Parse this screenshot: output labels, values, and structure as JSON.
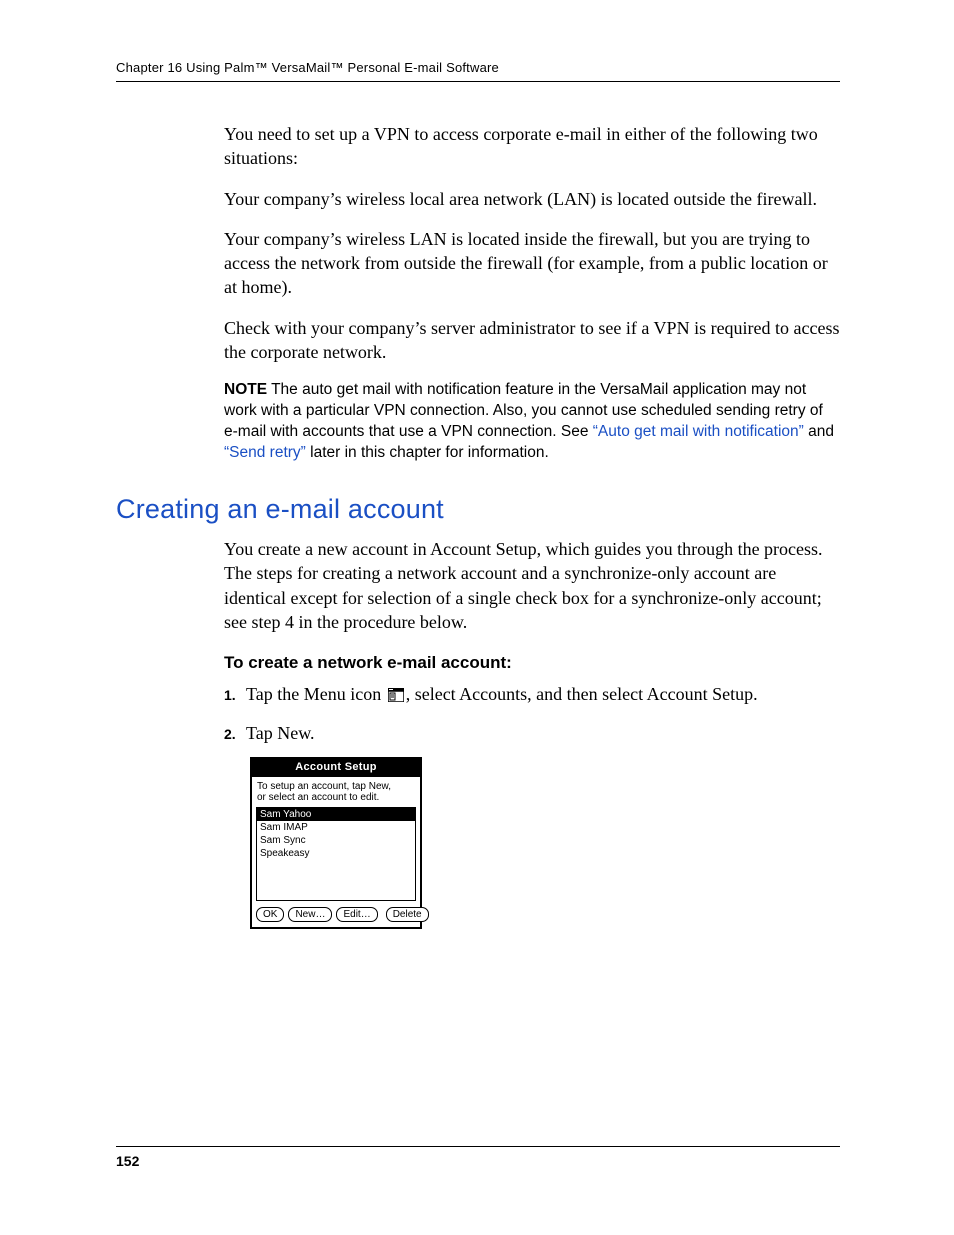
{
  "header": {
    "chapter_line": "Chapter 16   Using Palm™ VersaMail™ Personal E-mail Software"
  },
  "intro_para": "You need to set up a VPN to access corporate e-mail in either of the following two situations:",
  "bullet1": "Your company’s wireless local area network (LAN) is located outside the firewall.",
  "bullet2": "Your company’s wireless LAN is located inside the firewall, but you are trying to access the network from outside the firewall (for example, from a public location or at home).",
  "check_para": "Check with your company’s server administrator to see if a VPN is required to access the corporate network.",
  "note": {
    "label": "NOTE",
    "text_before": "  The auto get mail with notification feature in the VersaMail application may not work with a particular VPN connection. Also, you cannot use scheduled sending retry of e-mail with accounts that use a VPN connection. See ",
    "link1": "“Auto get mail with notification”",
    "mid": " and ",
    "link2": "“Send retry”",
    "after": " later in this chapter for information."
  },
  "section_heading": "Creating an e-mail account",
  "section_body": "You create a new account in Account Setup, which guides you through the process. The steps for creating a network account and a synchronize-only account are identical except for selection of a single check box for a synchronize-only account; see step 4 in the procedure below.",
  "proc_title": "To create a network e-mail account:",
  "steps": [
    {
      "n": "1.",
      "before": "Tap the Menu icon ",
      "after": ", select Accounts, and then select Account Setup."
    },
    {
      "n": "2.",
      "before": "Tap New.",
      "after": ""
    }
  ],
  "shot": {
    "title": "Account Setup",
    "hint1": "To setup an account, tap New,",
    "hint2": "or select an account to edit.",
    "rows": [
      "Sam Yahoo",
      "Sam IMAP",
      "Sam Sync",
      "Speakeasy"
    ],
    "buttons": {
      "ok": "OK",
      "new": "New…",
      "edit": "Edit…",
      "del": "Delete"
    }
  },
  "page_number": "152"
}
